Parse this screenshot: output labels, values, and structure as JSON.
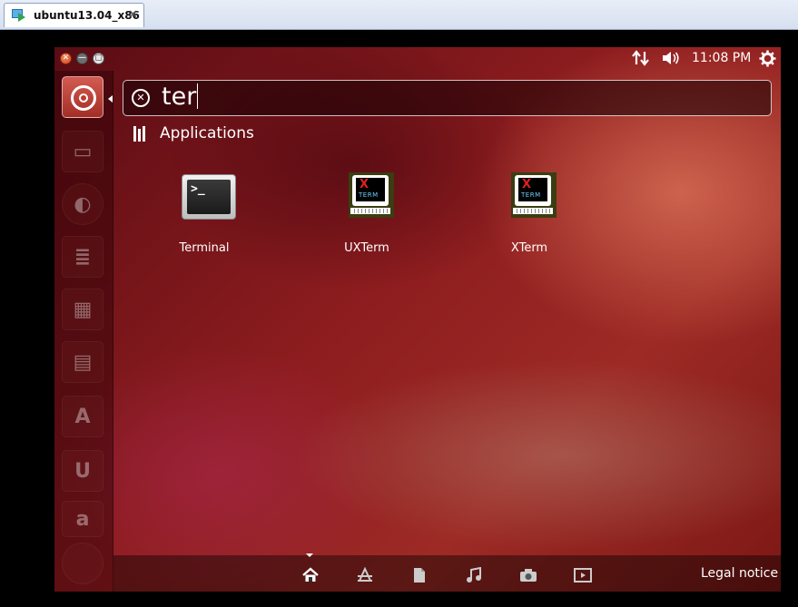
{
  "host": {
    "tab_title": "ubuntu13.04_x86",
    "close_glyph": "✕"
  },
  "panel": {
    "window_controls": [
      {
        "name": "close-window-button",
        "glyph": "✕"
      },
      {
        "name": "minimize-window-button",
        "glyph": "—"
      },
      {
        "name": "maximize-window-button",
        "glyph": "▢"
      }
    ],
    "clock": "11:08 PM",
    "indicators": [
      "network-icon",
      "volume-icon",
      "session-gear-icon"
    ]
  },
  "launcher": {
    "items": [
      {
        "name": "dash-home-icon",
        "active": true
      },
      {
        "name": "files-icon",
        "glyph": "▭"
      },
      {
        "name": "firefox-icon",
        "glyph": "◐"
      },
      {
        "name": "writer-icon",
        "glyph": "≣"
      },
      {
        "name": "calc-icon",
        "glyph": "▦"
      },
      {
        "name": "impress-icon",
        "glyph": "▤"
      },
      {
        "name": "software-center-icon",
        "glyph": "A"
      },
      {
        "name": "ubuntu-one-icon",
        "glyph": "U"
      },
      {
        "name": "amazon-icon",
        "glyph": "a"
      }
    ]
  },
  "search": {
    "query": "ter"
  },
  "category": {
    "title": "Applications"
  },
  "results": [
    {
      "label": "Terminal",
      "icon": "terminal-icon"
    },
    {
      "label": "UXTerm",
      "icon": "uxterm-icon",
      "letter": "X",
      "sub": "TERM"
    },
    {
      "label": "XTerm",
      "icon": "xterm-icon",
      "letter": "X",
      "sub": "TERM"
    }
  ],
  "terminal_prompt": ">_",
  "lenses": [
    "home-lens-icon",
    "applications-lens-icon",
    "files-lens-icon",
    "music-lens-icon",
    "photos-lens-icon",
    "video-lens-icon"
  ],
  "legal": "Legal notice",
  "colors": {
    "accent": "#c0392b",
    "text": "#ffffff"
  }
}
